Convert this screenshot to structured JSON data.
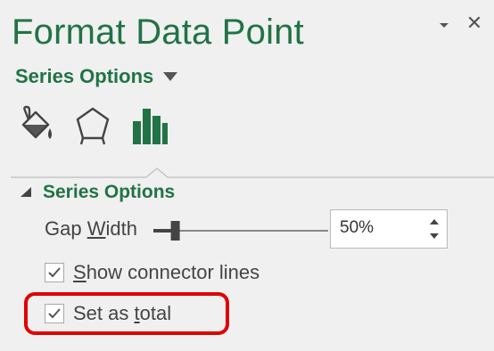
{
  "pane": {
    "title": "Format Data Point",
    "menu_icon": "chevron-down-icon",
    "close_icon": "close-icon",
    "close_glyph": "✕"
  },
  "options_dropdown": {
    "label": "Series Options"
  },
  "tabs": [
    {
      "name": "fill-line-icon",
      "selected": false
    },
    {
      "name": "effects-icon",
      "selected": false
    },
    {
      "name": "series-options-icon",
      "selected": true
    }
  ],
  "section": {
    "label": "Series Options",
    "expanded": true
  },
  "gap_width": {
    "label_prefix": "Gap ",
    "label_access_key": "W",
    "label_suffix": "idth",
    "value": "50%",
    "slider_fraction": 0.1
  },
  "checkboxes": {
    "connector_lines": {
      "label_access_key": "S",
      "label_rest": "how connector lines",
      "checked": true
    },
    "set_as_total": {
      "label_prefix": "Set as ",
      "label_access_key": "t",
      "label_suffix": "otal",
      "checked": true
    }
  },
  "colors": {
    "accent_green": "#217346",
    "highlight_red": "#e00000",
    "pane_bg": "#f0f0f0"
  }
}
